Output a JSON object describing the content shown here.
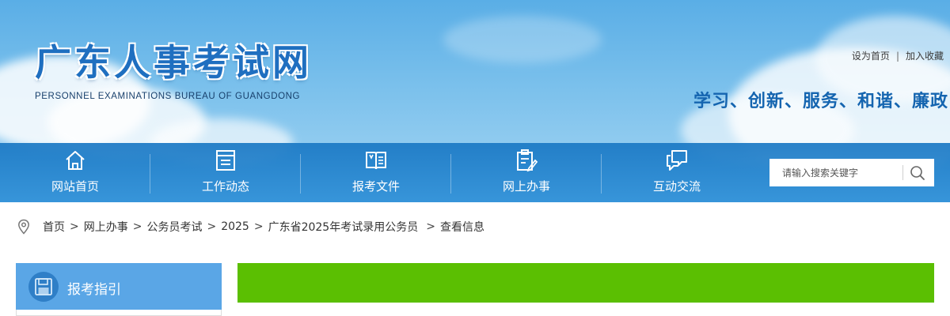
{
  "header": {
    "logo_cn": "广东人事考试网",
    "logo_en": "PERSONNEL EXAMINATIONS BUREAU OF GUANGDONG",
    "top_links": [
      "设为首页",
      "加入收藏"
    ],
    "slogan": "学习、创新、服务、和谐、廉政"
  },
  "nav": {
    "items": [
      {
        "label": "网站首页",
        "icon": "home-icon"
      },
      {
        "label": "工作动态",
        "icon": "news-icon"
      },
      {
        "label": "报考文件",
        "icon": "book-icon"
      },
      {
        "label": "网上办事",
        "icon": "clipboard-edit-icon"
      },
      {
        "label": "互动交流",
        "icon": "chat-bubbles-icon"
      }
    ],
    "search_placeholder": "请输入搜索关键字",
    "search_icon": "search-icon"
  },
  "breadcrumb": {
    "icon": "location-pin-icon",
    "items": [
      "首页",
      "网上办事",
      "公务员考试",
      "2025",
      "广东省2025年考试录用公务员"
    ],
    "current": "查看信息"
  },
  "sidebar": {
    "title": "报考指引",
    "icon": "floppy-disk-icon"
  },
  "colors": {
    "nav_bar": "#1f7ec8",
    "sidebar_header": "#5aa6e6",
    "main_bar": "#5bbf02",
    "logo": "#1f6fc0"
  }
}
